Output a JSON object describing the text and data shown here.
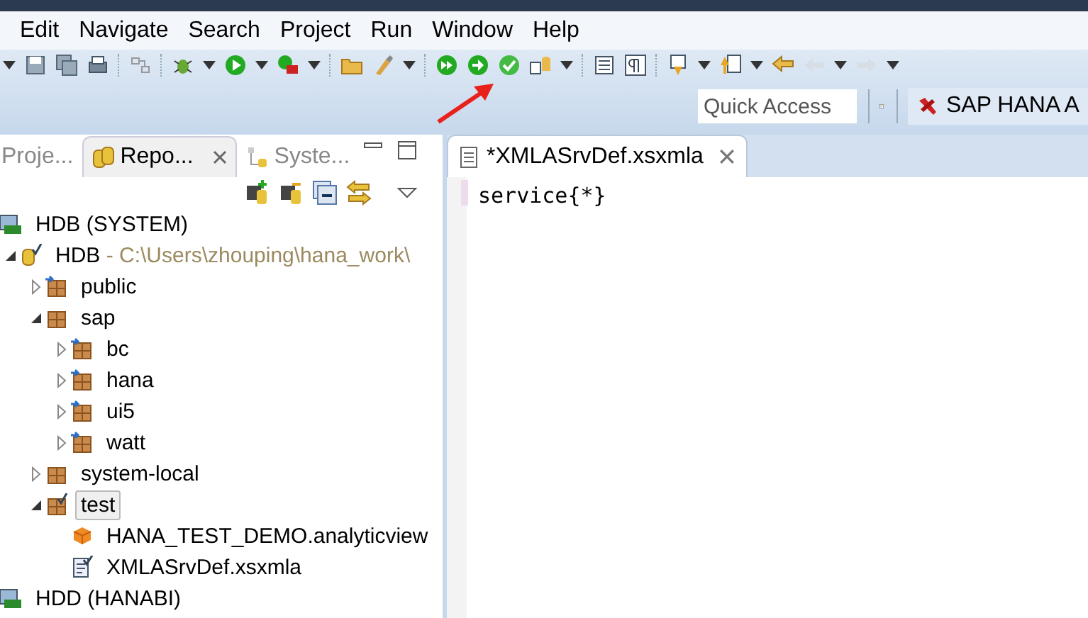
{
  "menu": [
    "Edit",
    "Navigate",
    "Search",
    "Project",
    "Run",
    "Window",
    "Help"
  ],
  "quick_access": {
    "placeholder": "Quick Access"
  },
  "perspective": {
    "label": "SAP HANA A"
  },
  "view_tabs": [
    {
      "label": "Proje...",
      "selected": false
    },
    {
      "label": "Repo...",
      "selected": true
    },
    {
      "label": "Syste...",
      "selected": false
    }
  ],
  "tree": [
    {
      "kind": "system",
      "label": "HDB (SYSTEM)",
      "children": [
        {
          "kind": "repository",
          "label": "HDB",
          "path": " - C:\\Users\\zhouping\\hana_work\\",
          "expanded": true,
          "children": [
            {
              "kind": "package-linked",
              "label": "public",
              "expanded": false
            },
            {
              "kind": "package",
              "label": "sap",
              "expanded": true,
              "children": [
                {
                  "kind": "package-linked",
                  "label": "bc",
                  "expanded": false
                },
                {
                  "kind": "package-linked",
                  "label": "hana",
                  "expanded": false
                },
                {
                  "kind": "package-linked",
                  "label": "ui5",
                  "expanded": false
                },
                {
                  "kind": "package-linked",
                  "label": "watt",
                  "expanded": false
                }
              ]
            },
            {
              "kind": "package",
              "label": "system-local",
              "expanded": false
            },
            {
              "kind": "package-checked",
              "label": "test",
              "expanded": true,
              "selected": true,
              "children": [
                {
                  "kind": "analytic-view",
                  "label": "HANA_TEST_DEMO.analyticview"
                },
                {
                  "kind": "file",
                  "label": "XMLASrvDef.xsxmla"
                }
              ]
            }
          ]
        }
      ]
    },
    {
      "kind": "system",
      "label": "HDD (HANABI)"
    }
  ],
  "editor": {
    "tab": "*XMLASrvDef.xsxmla",
    "lines": [
      "service{*}"
    ]
  }
}
